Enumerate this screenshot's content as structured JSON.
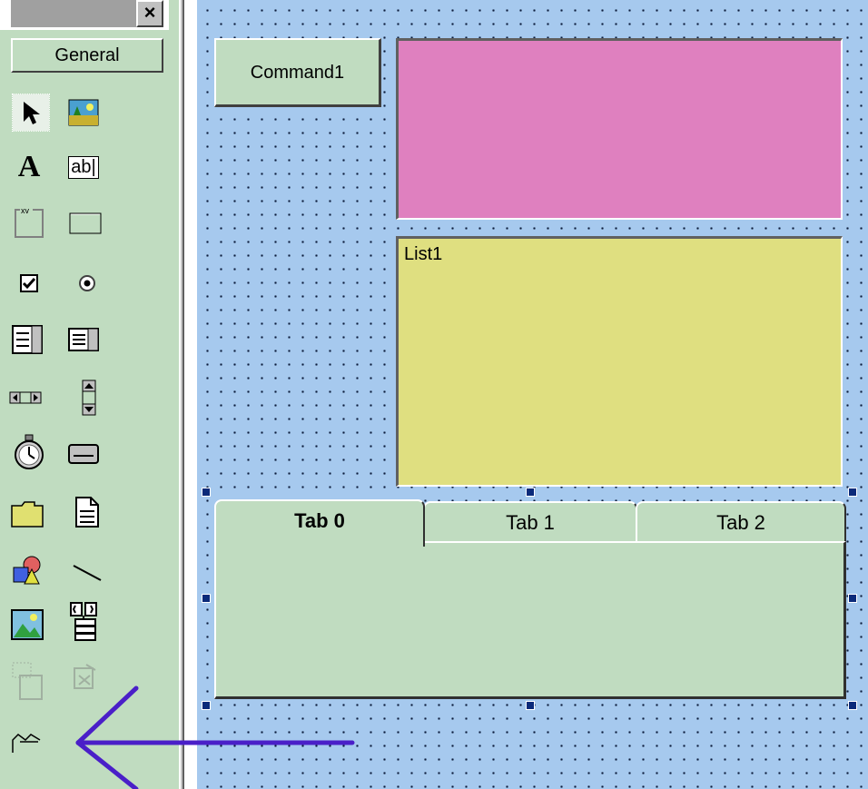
{
  "toolbox": {
    "close_label": "×",
    "tab_label": "General",
    "tools": [
      {
        "name": "pointer-icon"
      },
      {
        "name": "picturebox-icon"
      },
      {
        "name": "label-icon",
        "glyph": "A"
      },
      {
        "name": "textbox-icon",
        "glyph": "ab|"
      },
      {
        "name": "frame-icon",
        "glyph": "xv"
      },
      {
        "name": "commandbutton-icon"
      },
      {
        "name": "checkbox-icon"
      },
      {
        "name": "optionbutton-icon"
      },
      {
        "name": "combobox-icon"
      },
      {
        "name": "listbox-icon"
      },
      {
        "name": "hscrollbar-icon"
      },
      {
        "name": "vscrollbar-icon"
      },
      {
        "name": "timer-icon"
      },
      {
        "name": "drivelistbox-icon"
      },
      {
        "name": "dirlistbox-icon"
      },
      {
        "name": "filelistbox-icon"
      },
      {
        "name": "shape-icon"
      },
      {
        "name": "line-icon"
      },
      {
        "name": "image-icon"
      },
      {
        "name": "data-icon"
      },
      {
        "name": "ole-icon"
      },
      {
        "name": "disabled-tool-icon"
      },
      {
        "name": "custom-control-icon"
      }
    ]
  },
  "form": {
    "command1_caption": "Command1",
    "list1_text": "List1",
    "tabs": [
      {
        "label": "Tab 0",
        "selected": true
      },
      {
        "label": "Tab 1",
        "selected": false
      },
      {
        "label": "Tab 2",
        "selected": false
      }
    ]
  },
  "colors": {
    "form_background": "#a6c9ee",
    "control_face": "#c0dcc0",
    "picture_fill": "#df80bf",
    "list_fill": "#dfdf80",
    "arrow": "#4a1fc8",
    "selection_handle": "#0b2a7a"
  }
}
